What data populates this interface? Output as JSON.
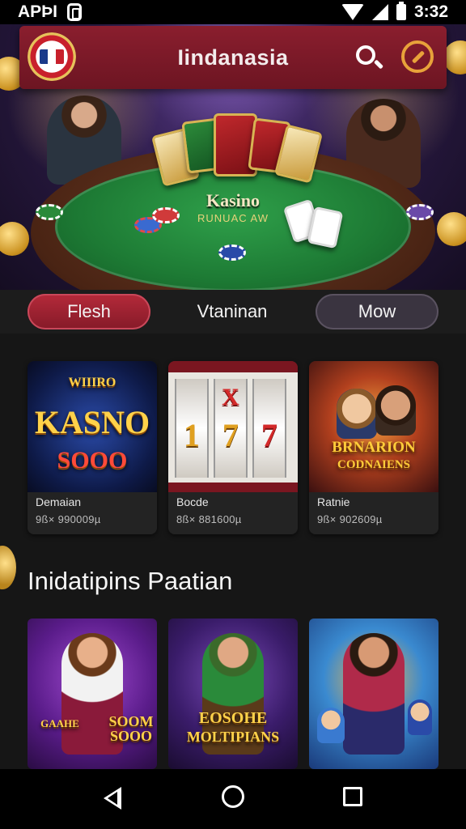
{
  "status_bar": {
    "left_text": "APÞI",
    "time": "3:32"
  },
  "header": {
    "title": "Iindanasia",
    "search_icon": "search-icon",
    "bonus_icon": "bonus-icon"
  },
  "hero": {
    "table_title": "Kasino",
    "table_subtitle": "RUNUAC AW"
  },
  "tabs": [
    {
      "label": "Flesh",
      "active": true
    },
    {
      "label": "Vtaninan",
      "active": false
    },
    {
      "label": "Mow",
      "active": false
    }
  ],
  "games": [
    {
      "thumb_top": "WIIIRO",
      "thumb_main": "KASNO",
      "thumb_sub": "SOOO",
      "name": "Demaian",
      "meta": "9ß× 990009µ"
    },
    {
      "thumb_symbols": [
        "X",
        "1",
        "7",
        "7"
      ],
      "name": "Bocde",
      "meta": "8ß× 881600µ"
    },
    {
      "thumb_main": "BRNARION",
      "thumb_sub": "CODNAIENS",
      "name": "Ratnie",
      "meta": "9ß× 902609µ"
    }
  ],
  "section": {
    "title": "Inidatipins Paatian"
  },
  "promos": [
    {
      "label_left": "GAAHE",
      "label_right": "SOOM\nSOOO"
    },
    {
      "label_top": "EOSOHE",
      "label_bottom": "MOLTIPIANS"
    },
    {
      "label": ""
    }
  ],
  "colors": {
    "header_bg": "#7a1a28",
    "tab_active": "#a02232",
    "bonus_accent": "#e8a23a",
    "card_bg": "#232323"
  },
  "nav": {
    "back_icon": "back-icon",
    "home_icon": "home-icon",
    "recents_icon": "recents-icon"
  }
}
